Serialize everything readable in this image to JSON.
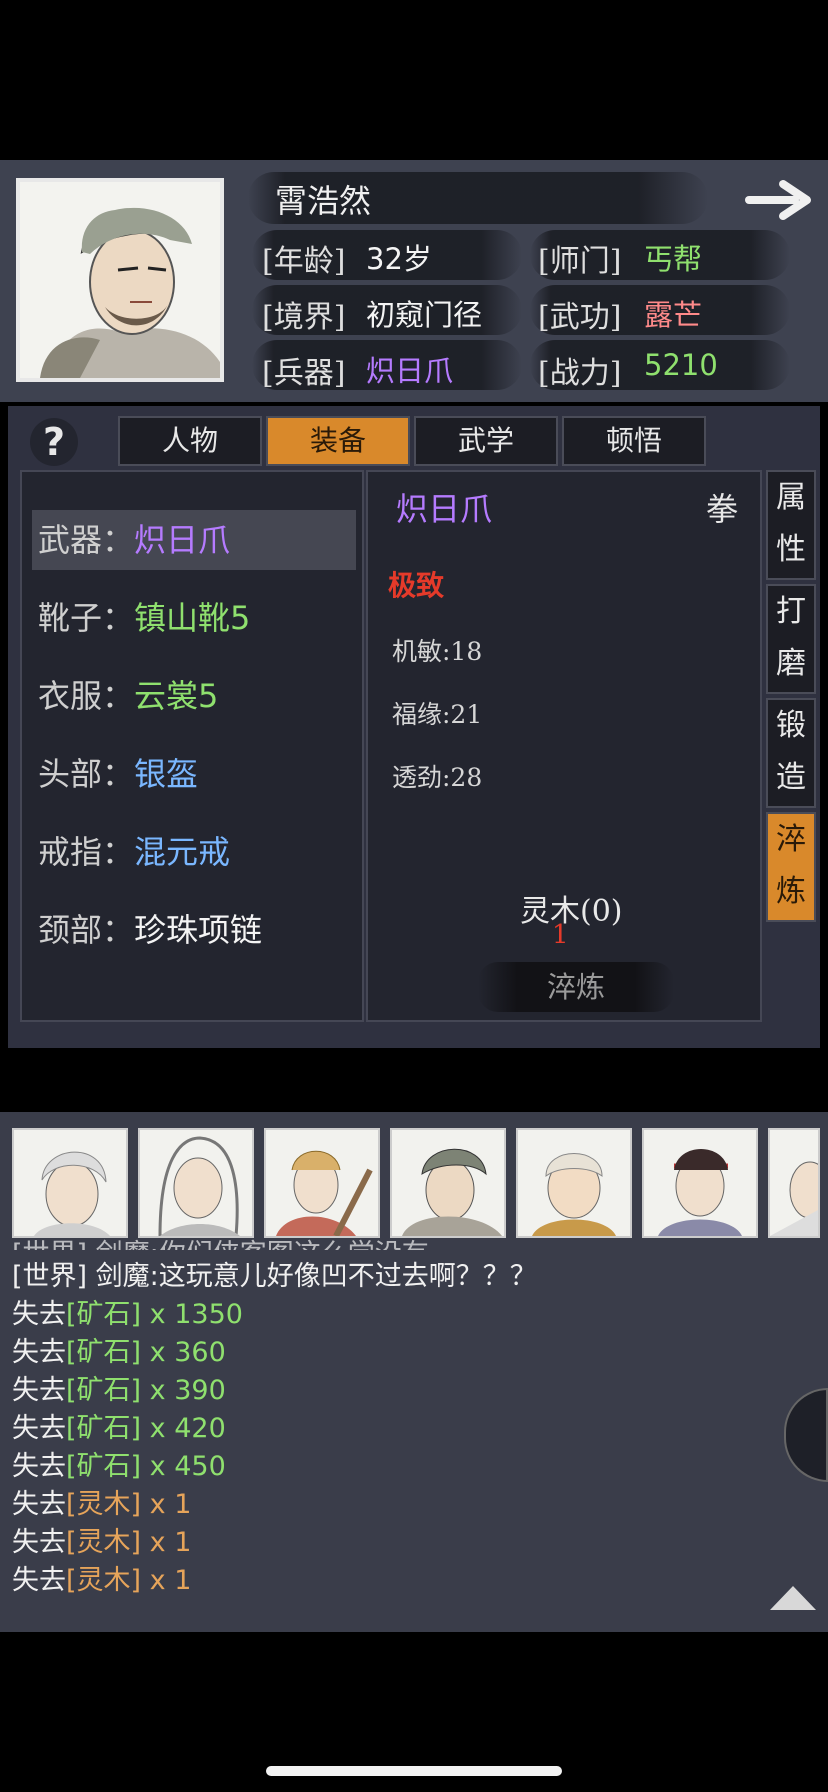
{
  "header": {
    "name": "霄浩然",
    "age_label": "[年龄]",
    "age": "32岁",
    "sect_label": "[师门]",
    "sect": "丐帮",
    "realm_label": "[境界]",
    "realm": "初窥门径",
    "skill_label": "[武功]",
    "skill": "露芒",
    "weapon_label": "[兵器]",
    "weapon": "炽日爪",
    "power_label": "[战力]",
    "power": "5210"
  },
  "tabs": [
    {
      "label": "人物",
      "active": false
    },
    {
      "label": "装备",
      "active": true
    },
    {
      "label": "武学",
      "active": false
    },
    {
      "label": "顿悟",
      "active": false
    }
  ],
  "help_label": "?",
  "equipment": [
    {
      "slot": "武器：",
      "item": "炽日爪",
      "color": "#b57bff",
      "selected": true
    },
    {
      "slot": "靴子：",
      "item": "镇山靴5",
      "color": "#8fe06e",
      "selected": false
    },
    {
      "slot": "衣服：",
      "item": "云裳5",
      "color": "#8fe06e",
      "selected": false
    },
    {
      "slot": "头部：",
      "item": "银盔",
      "color": "#7ab7ff",
      "selected": false
    },
    {
      "slot": "戒指：",
      "item": "混元戒",
      "color": "#7ab7ff",
      "selected": false
    },
    {
      "slot": "颈部：",
      "item": "珍珠项链",
      "color": "#f4f4f4",
      "selected": false
    }
  ],
  "detail": {
    "item_name": "炽日爪",
    "item_type": "拳",
    "quality": "极致",
    "stats": [
      "机敏:18",
      "福缘:21",
      "透劲:28"
    ],
    "material": "灵木(0)",
    "material_cost": "1",
    "refine_button": "淬炼"
  },
  "side_tabs": [
    {
      "label1": "属",
      "label2": "性",
      "active": false
    },
    {
      "label1": "打",
      "label2": "磨",
      "active": false
    },
    {
      "label1": "锻",
      "label2": "造",
      "active": false
    },
    {
      "label1": "淬",
      "label2": "炼",
      "active": true
    }
  ],
  "chat": {
    "partial_line": "[世界] 剑魔:你们侠客图这么学没有",
    "world_tag": "[世界]",
    "world_msg": "剑魔:这玩意儿好像凹不过去啊？？？",
    "losses": [
      {
        "prefix": "失去",
        "item": "[矿石]",
        "qty": "x 1350",
        "color": "#8fe06e"
      },
      {
        "prefix": "失去",
        "item": "[矿石]",
        "qty": "x 360",
        "color": "#8fe06e"
      },
      {
        "prefix": "失去",
        "item": "[矿石]",
        "qty": "x 390",
        "color": "#8fe06e"
      },
      {
        "prefix": "失去",
        "item": "[矿石]",
        "qty": "x 420",
        "color": "#8fe06e"
      },
      {
        "prefix": "失去",
        "item": "[矿石]",
        "qty": "x 450",
        "color": "#8fe06e"
      },
      {
        "prefix": "失去",
        "item": "[灵木]",
        "qty": "x 1",
        "color": "#e6a45a"
      },
      {
        "prefix": "失去",
        "item": "[灵木]",
        "qty": "x 1",
        "color": "#e6a45a"
      },
      {
        "prefix": "失去",
        "item": "[灵木]",
        "qty": "x 1",
        "color": "#e6a45a"
      }
    ]
  }
}
